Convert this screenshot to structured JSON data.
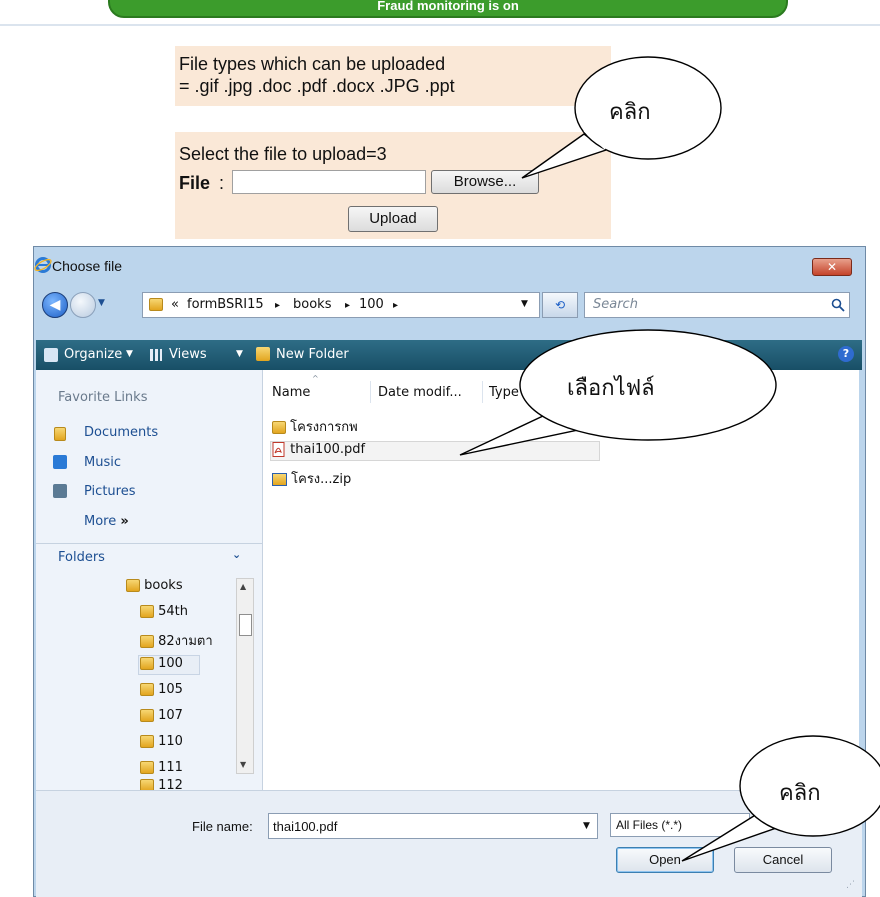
{
  "top_banner": {
    "text": "Fraud monitoring is on"
  },
  "upload_form": {
    "filetypes_line1": "File types which can be uploaded",
    "filetypes_line2": "= .gif .jpg .doc .pdf .docx .JPG .ppt",
    "select_label": "Select the file to upload=3",
    "file_label": "File",
    "file_colon": ":",
    "browse_label": "Browse...",
    "upload_label": "Upload"
  },
  "dialog": {
    "title": "Choose file",
    "close_glyph": "✕",
    "breadcrumb": {
      "prefix": "«",
      "items": [
        "formBSRI15",
        "books",
        "100"
      ],
      "sep": "▸"
    },
    "search_placeholder": "Search",
    "toolbar": {
      "organize": "Organize",
      "views": "Views",
      "new_folder": "New Folder"
    },
    "favorite_links": {
      "heading": "Favorite Links",
      "items": [
        "Documents",
        "Music",
        "Pictures"
      ],
      "more": "More",
      "more_glyph": "»"
    },
    "folders": {
      "heading": "Folders",
      "items": [
        "books",
        "54th",
        "82งามตา",
        "100",
        "105",
        "107",
        "110",
        "111",
        "112"
      ],
      "selected": "100"
    },
    "columns": [
      "Name",
      "Date modif...",
      "Type"
    ],
    "files": [
      {
        "name": "โครงการกพ",
        "icon": "folder-icon"
      },
      {
        "name": "thai100.pdf",
        "icon": "pdf-icon"
      },
      {
        "name": "โครง...zip",
        "icon": "zip-icon"
      }
    ],
    "file_name_label": "File name:",
    "file_name_value": "thai100.pdf",
    "filter_value": "All Files (*.*)",
    "open_label": "Open",
    "cancel_label": "Cancel"
  },
  "callouts": {
    "click_browse": "คลิก",
    "select_file": "เลือกไฟล์",
    "click_open": "คลิก"
  }
}
